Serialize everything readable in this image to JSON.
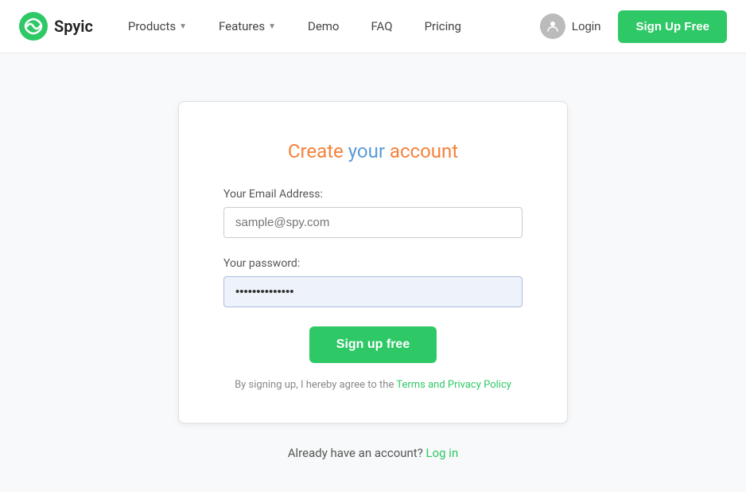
{
  "brand": {
    "name": "Spyic"
  },
  "nav": {
    "products_label": "Products",
    "features_label": "Features",
    "demo_label": "Demo",
    "faq_label": "FAQ",
    "pricing_label": "Pricing",
    "login_label": "Login",
    "signup_label": "Sign Up Free"
  },
  "form": {
    "title_part1": "Create ",
    "title_your": "your",
    "title_part2": " account",
    "email_label": "Your Email Address:",
    "email_placeholder": "sample@spy.com",
    "email_value": "",
    "password_label": "Your password:",
    "password_placeholder": "",
    "password_value": "••••••••••••",
    "submit_label": "Sign up free",
    "terms_prefix": "By signing up, I hereby agree to the ",
    "terms_link": "Terms and Privacy Policy"
  },
  "footer_text": {
    "prefix": "Already have an account? ",
    "login_link": "Log in"
  }
}
